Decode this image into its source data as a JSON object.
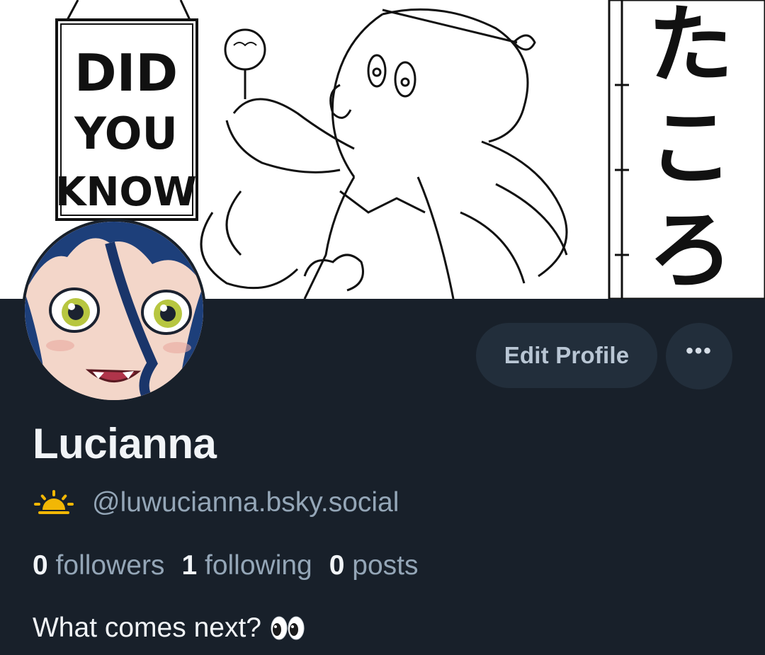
{
  "banner": {
    "sign_lines": [
      "DID",
      "YOU",
      "KNOW"
    ],
    "vertical_text": "たこ",
    "alt": "profile-banner"
  },
  "profile": {
    "display_name": "Lucianna",
    "handle": "@luwucianna.bsky.social",
    "handle_prefix_icon": "sun-emoji-icon",
    "bio": "What comes next?",
    "bio_suffix_icon": "eyes-emoji-icon"
  },
  "actions": {
    "edit_profile_label": "Edit Profile",
    "more_label": "•••"
  },
  "stats": {
    "followers_count": "0",
    "followers_label": "followers",
    "following_count": "1",
    "following_label": "following",
    "posts_count": "0",
    "posts_label": "posts"
  },
  "colors": {
    "background": "#18202a",
    "button_bg": "#222e3b",
    "muted_text": "#94a6b7",
    "primary_text": "#f1f4f7",
    "accent_sun": "#f2b705"
  }
}
